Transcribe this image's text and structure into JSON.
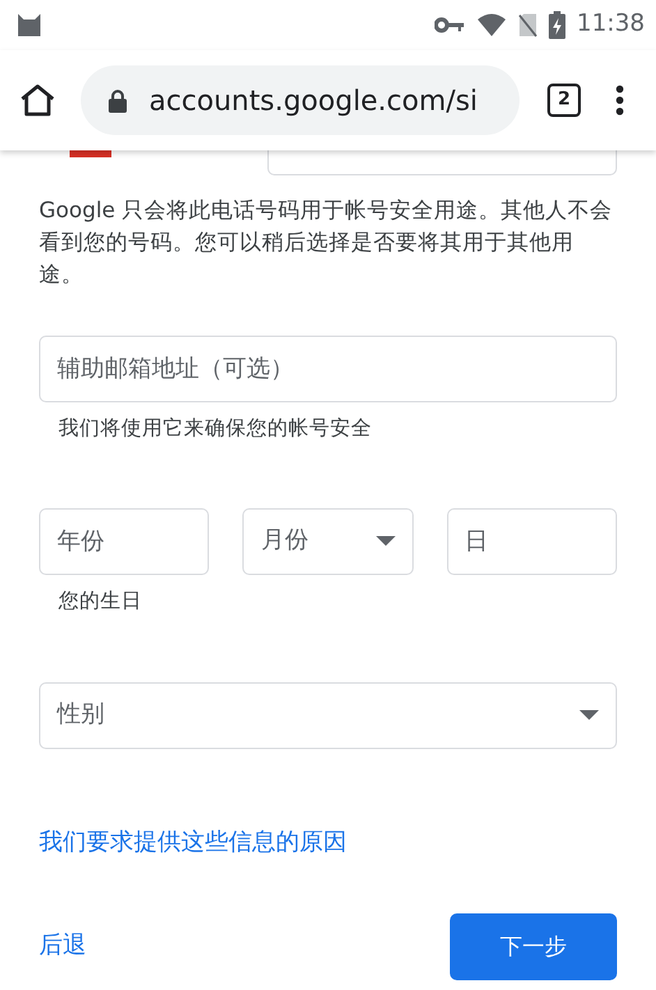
{
  "status_bar": {
    "time": "11:38"
  },
  "browser": {
    "url": "accounts.google.com/si",
    "tab_count": "2"
  },
  "notice": "Google 只会将此电话号码用于帐号安全用途。其他人不会看到您的号码。您可以稍后选择是否要将其用于其他用途。",
  "recovery_email": {
    "placeholder": "辅助邮箱地址（可选）",
    "hint": "我们将使用它来确保您的帐号安全"
  },
  "birthday": {
    "fields": [
      {
        "kind": "input",
        "placeholder": "年份"
      },
      {
        "kind": "select",
        "placeholder": "月份"
      },
      {
        "kind": "input",
        "placeholder": "日"
      }
    ],
    "hint": "您的生日"
  },
  "gender": {
    "kind": "select",
    "placeholder": "性别"
  },
  "reason_link": "我们要求提供这些信息的原因",
  "buttons": {
    "back": "后退",
    "next": "下一步"
  }
}
